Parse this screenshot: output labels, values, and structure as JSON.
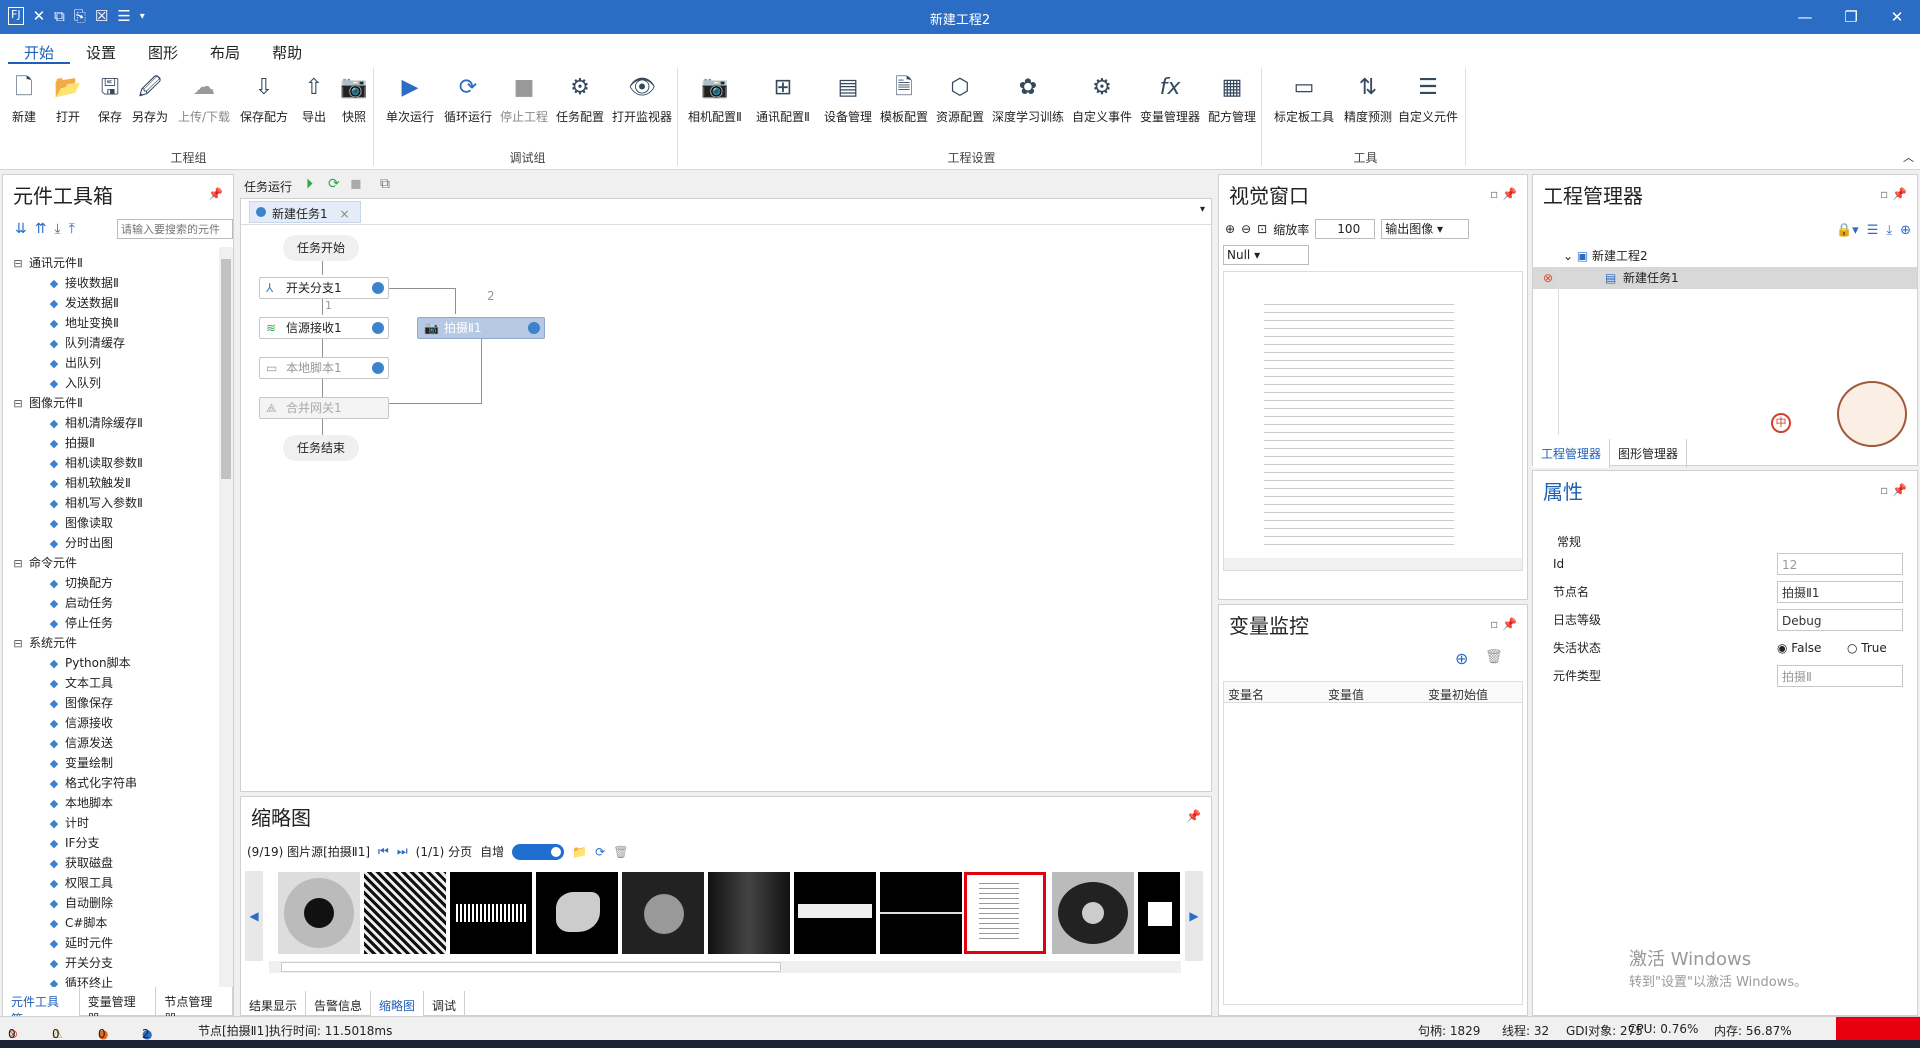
{
  "window": {
    "title": "新建工程2"
  },
  "menu": [
    "开始",
    "设置",
    "图形",
    "布局",
    "帮助"
  ],
  "ribbon": {
    "groups": [
      "工程组",
      "调试组",
      "工程设置",
      "工具"
    ],
    "file": [
      "新建",
      "打开",
      "保存",
      "另存为",
      "上传/下载",
      "保存配方",
      "导出",
      "快照"
    ],
    "debug": [
      "单次运行",
      "循环运行",
      "停止工程",
      "任务配置",
      "打开监视器"
    ],
    "settings": [
      "相机配置Ⅱ",
      "通讯配置Ⅱ",
      "设备管理",
      "模板配置",
      "资源配置",
      "深度学习训练",
      "自定义事件",
      "变量管理器",
      "配方管理"
    ],
    "tools": [
      "标定板工具",
      "精度预测",
      "自定义元件"
    ]
  },
  "toolbox": {
    "title": "元件工具箱",
    "search_placeholder": "请输入要搜索的元件",
    "items": [
      {
        "t": "通讯元件Ⅱ",
        "g": true
      },
      {
        "t": "接收数据Ⅱ"
      },
      {
        "t": "发送数据Ⅱ"
      },
      {
        "t": "地址变换Ⅱ"
      },
      {
        "t": "队列清缓存"
      },
      {
        "t": "出队列"
      },
      {
        "t": "入队列"
      },
      {
        "t": "图像元件Ⅱ",
        "g": true
      },
      {
        "t": "相机清除缓存Ⅱ"
      },
      {
        "t": "拍摄Ⅱ"
      },
      {
        "t": "相机读取参数Ⅱ"
      },
      {
        "t": "相机软触发Ⅱ"
      },
      {
        "t": "相机写入参数Ⅱ"
      },
      {
        "t": "图像读取"
      },
      {
        "t": "分时出图"
      },
      {
        "t": "命令元件",
        "g": true
      },
      {
        "t": "切换配方"
      },
      {
        "t": "启动任务"
      },
      {
        "t": "停止任务"
      },
      {
        "t": "系统元件",
        "g": true
      },
      {
        "t": "Python脚本"
      },
      {
        "t": "文本工具"
      },
      {
        "t": "图像保存"
      },
      {
        "t": "信源接收"
      },
      {
        "t": "信源发送"
      },
      {
        "t": "变量绘制"
      },
      {
        "t": "格式化字符串"
      },
      {
        "t": "本地脚本"
      },
      {
        "t": "计时"
      },
      {
        "t": "IF分支"
      },
      {
        "t": "获取磁盘"
      },
      {
        "t": "权限工具"
      },
      {
        "t": "自动删除"
      },
      {
        "t": "C#脚本"
      },
      {
        "t": "延时元件"
      },
      {
        "t": "开关分支"
      },
      {
        "t": "循环终止"
      }
    ],
    "tabs": [
      "元件工具箱",
      "变量管理器",
      "节点管理器"
    ]
  },
  "task": {
    "toolbar_label": "任务运行",
    "tab": "新建任务1",
    "flow": {
      "start": "任务开始",
      "end": "任务结束",
      "switch": "开关分支1",
      "recv": "信源接收1",
      "script": "本地脚本1",
      "merge": "合并网关1",
      "capture": "拍摄Ⅱ1",
      "b1": "1",
      "b2": "2"
    }
  },
  "thumbs": {
    "title": "缩略图",
    "info": "(9/19) 图片源[拍摄Ⅱ1]",
    "page": "(1/1) 分页",
    "auto": "自增",
    "tabs": [
      "结果显示",
      "告警信息",
      "缩略图",
      "调试"
    ]
  },
  "vision": {
    "title": "视觉窗口",
    "zoom_label": "缩放率",
    "zoom": "100",
    "output": "输出图像",
    "select": "Null"
  },
  "varmon": {
    "title": "变量监控",
    "cols": [
      "变量名",
      "变量值",
      "变量初始值"
    ]
  },
  "project": {
    "title": "工程管理器",
    "root": "新建工程2",
    "child": "新建任务1",
    "tabs": [
      "工程管理器",
      "图形管理器"
    ]
  },
  "props": {
    "title": "属性",
    "section": "常规",
    "rows": [
      {
        "k": "Id",
        "v": "12"
      },
      {
        "k": "节点名",
        "v": "拍摄Ⅱ1"
      },
      {
        "k": "日志等级",
        "v": "Debug"
      },
      {
        "k": "失活状态",
        "v": ""
      },
      {
        "k": "元件类型",
        "v": "拍摄Ⅱ"
      }
    ],
    "false": "False",
    "true": "True"
  },
  "watermark": {
    "line1": "激活 Windows",
    "line2": "转到\"设置\"以激活 Windows。"
  },
  "status": {
    "err": "0",
    "warn": "0",
    "c3": "0",
    "c4": "2",
    "msg": "节点[拍摄Ⅱ1]执行时间: 11.5018ms",
    "handles": "句柄: 1829",
    "threads": "线程: 32",
    "gdi": "GDI对象: 275",
    "cpu": "CPU: 0.76%",
    "mem": "内存: 56.87%"
  },
  "colors": {
    "accent": "#2b6cc4",
    "selected": "#1f5fb8",
    "status_alert": "#e8000f"
  }
}
